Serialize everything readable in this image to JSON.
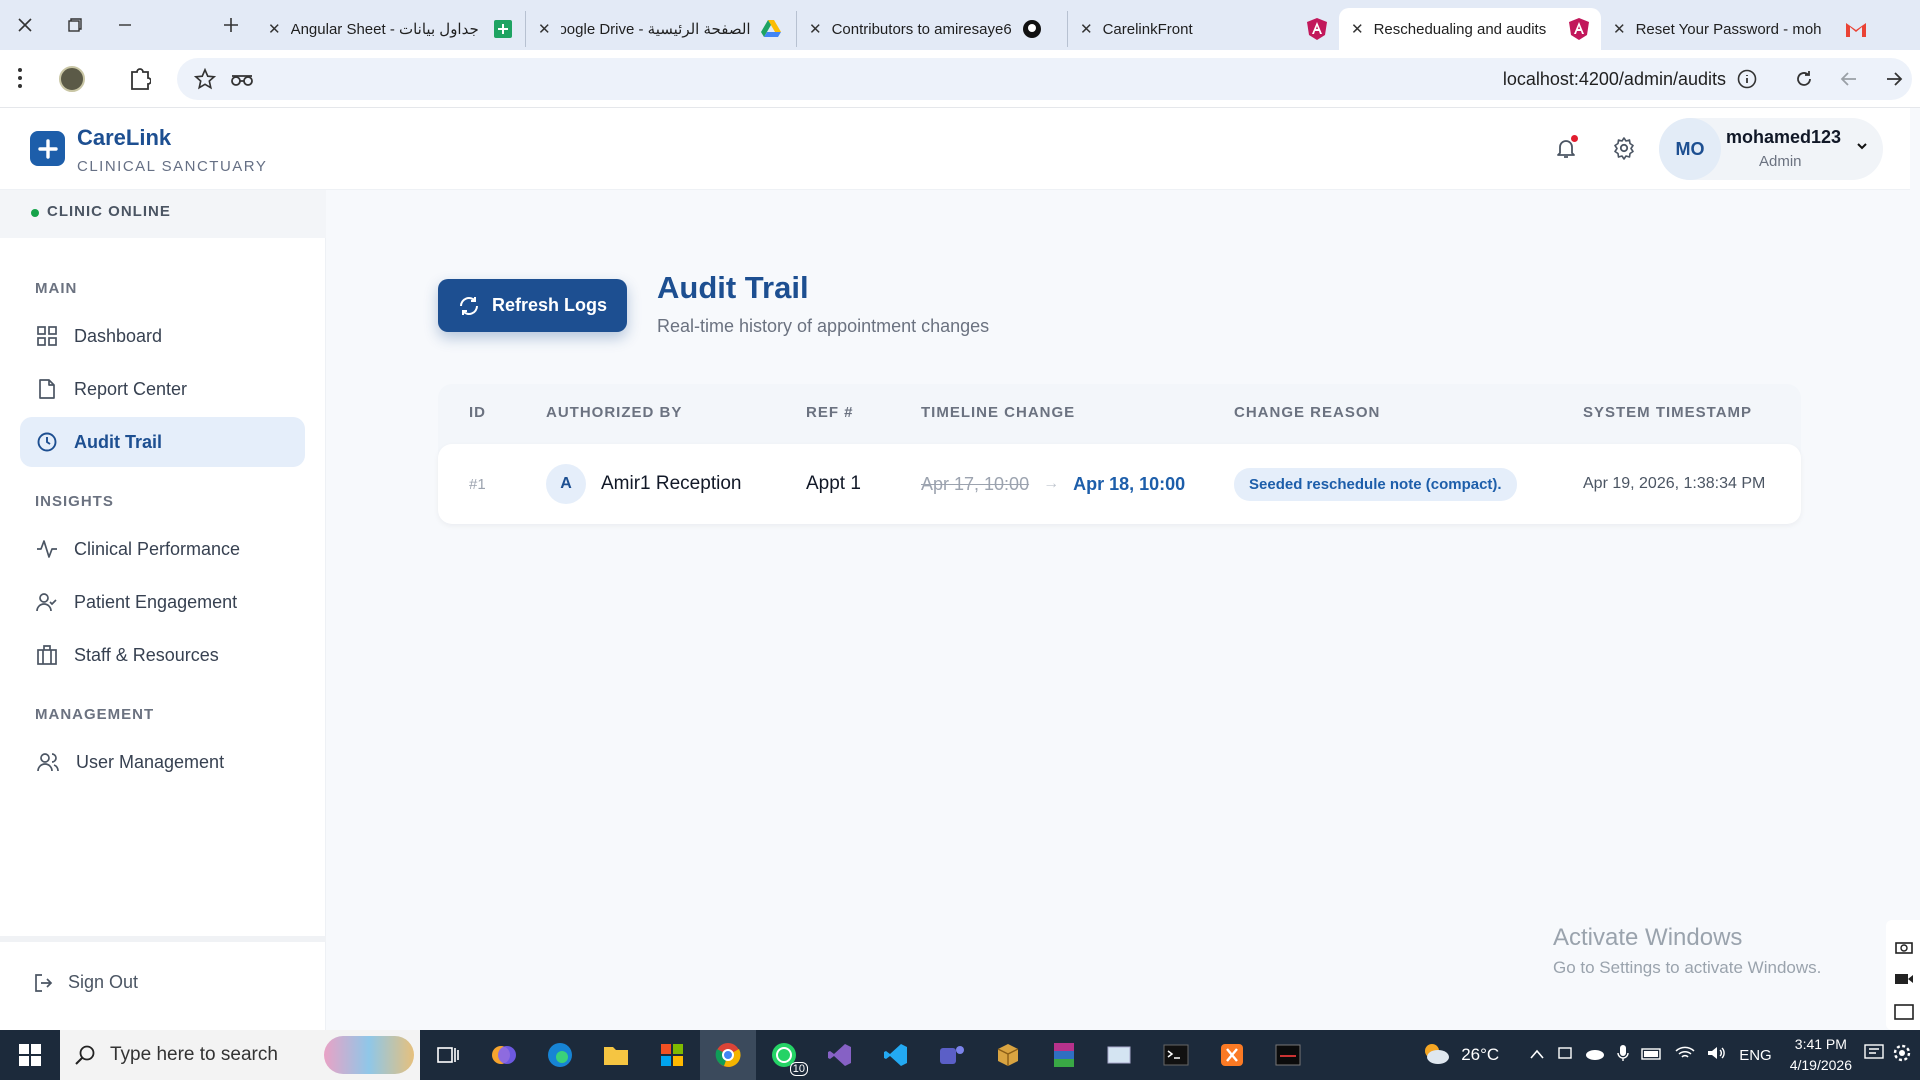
{
  "browser": {
    "tabs": [
      {
        "title": "Angular Sheet - جداول بيانات",
        "icon": "sheets-icon"
      },
      {
        "title": "الصفحة الرئيسية - Google Drive",
        "icon": "drive-icon"
      },
      {
        "title": "Contributors to amiresaye6",
        "icon": "github-icon"
      },
      {
        "title": "CarelinkFront",
        "icon": "angular-icon"
      },
      {
        "title": "Reschedualing and audits",
        "icon": "angular-icon"
      },
      {
        "title": "Reset Your Password - moh",
        "icon": "gmail-icon"
      }
    ],
    "url": "localhost:4200/admin/audits"
  },
  "app": {
    "brand": {
      "name": "CareLink",
      "subtitle": "CLINICAL SANCTUARY"
    },
    "user": {
      "initials": "MO",
      "name": "mohamed123",
      "role": "Admin"
    }
  },
  "sidebar": {
    "status": "CLINIC ONLINE",
    "sections": [
      {
        "label": "MAIN",
        "items": [
          "Dashboard",
          "Report Center",
          "Audit Trail"
        ]
      },
      {
        "label": "INSIGHTS",
        "items": [
          "Clinical Performance",
          "Patient Engagement",
          "Staff & Resources"
        ]
      },
      {
        "label": "MANAGEMENT",
        "items": [
          "User Management"
        ]
      }
    ],
    "active": "Audit Trail",
    "signout": "Sign Out"
  },
  "main": {
    "refresh_label": "Refresh Logs",
    "title": "Audit Trail",
    "subtitle": "Real-time history of appointment changes",
    "table": {
      "headers": [
        "ID",
        "AUTHORIZED BY",
        "REF #",
        "TIMELINE CHANGE",
        "CHANGE REASON",
        "SYSTEM TIMESTAMP"
      ],
      "rows": [
        {
          "id": "#1",
          "author_initial": "A",
          "author": "Amir1 Reception",
          "ref": "Appt 1",
          "from": "Apr 17, 10:00",
          "to": "Apr 18, 10:00",
          "reason": "Seeded reschedule note (compact).",
          "timestamp": "Apr 19, 2026, 1:38:34 PM"
        }
      ]
    }
  },
  "watermark": {
    "line1": "Activate Windows",
    "line2": "Go to Settings to activate Windows."
  },
  "taskbar": {
    "search_placeholder": "Type here to search",
    "weather": "26°C",
    "lang": "ENG",
    "time": "3:41 PM",
    "date": "4/19/2026",
    "whatsapp_badge": "10"
  },
  "colors": {
    "primary": "#1d4f91",
    "accent": "#1d5eaa",
    "online": "#16a34a"
  }
}
